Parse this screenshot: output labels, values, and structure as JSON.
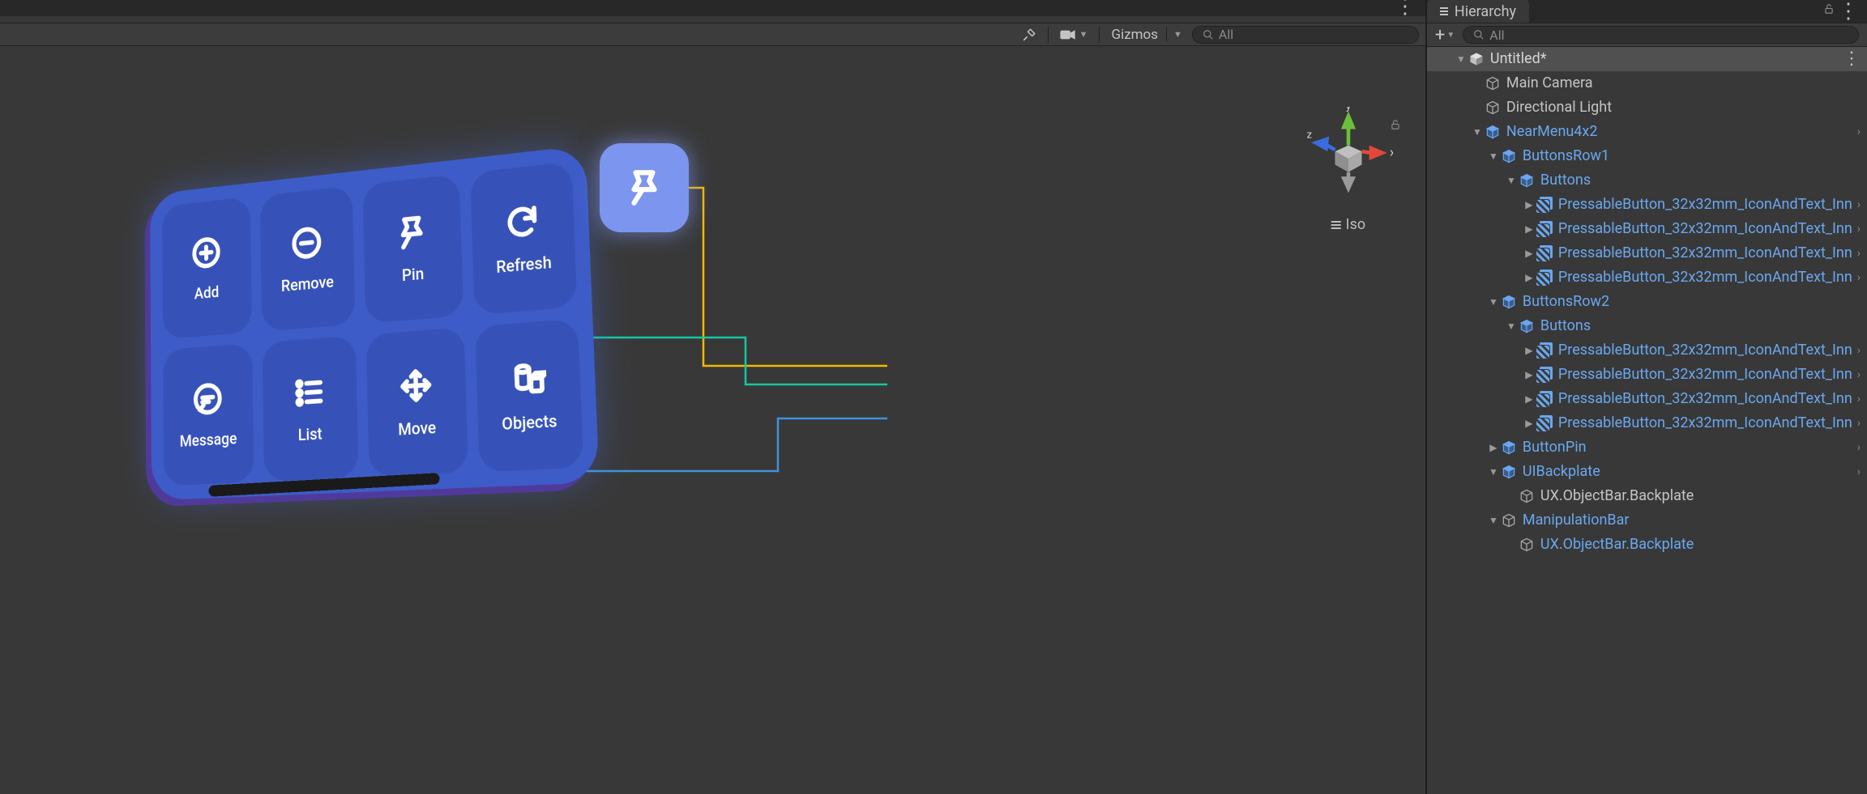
{
  "scene": {
    "toolbar": {
      "gizmos_label": "Gizmos",
      "search_placeholder": "All"
    },
    "view_mode_label": "Iso",
    "axes": {
      "x": "x",
      "y": "y",
      "z": "z"
    },
    "nearmenu_buttons": [
      {
        "label": "Add",
        "icon": "plus-circle-icon"
      },
      {
        "label": "Remove",
        "icon": "minus-circle-icon"
      },
      {
        "label": "Pin",
        "icon": "pin-icon"
      },
      {
        "label": "Refresh",
        "icon": "refresh-icon"
      },
      {
        "label": "Message",
        "icon": "message-icon"
      },
      {
        "label": "List",
        "icon": "list-icon"
      },
      {
        "label": "Move",
        "icon": "move-icon"
      },
      {
        "label": "Objects",
        "icon": "objects-icon"
      }
    ],
    "connectors": [
      {
        "color": "#f2b900",
        "from": "pin-button",
        "to": "ButtonPin"
      },
      {
        "color": "#14c8a0",
        "from": "ui-backplate",
        "to": "UIBackplate"
      },
      {
        "color": "#3f93d9",
        "from": "manipulation-bar",
        "to": "ManipulationBar"
      }
    ]
  },
  "hierarchy": {
    "panel_title": "Hierarchy",
    "add_label": "+",
    "search_placeholder": "All",
    "scene_name": "Untitled*",
    "items": [
      {
        "depth": 1,
        "label": "Main Camera",
        "icon": "cube-gray",
        "color": "gray",
        "arrow": ""
      },
      {
        "depth": 1,
        "label": "Directional Light",
        "icon": "cube-gray",
        "color": "gray",
        "arrow": ""
      },
      {
        "depth": 1,
        "label": "NearMenu4x2",
        "icon": "cube-blue",
        "color": "blue",
        "arrow": "down",
        "chev": true
      },
      {
        "depth": 2,
        "label": "ButtonsRow1",
        "icon": "cube-blue",
        "color": "blue",
        "arrow": "down"
      },
      {
        "depth": 3,
        "label": "Buttons",
        "icon": "cube-blue",
        "color": "blue",
        "arrow": "down"
      },
      {
        "depth": 4,
        "label": "PressableButton_32x32mm_IconAndText_Inn",
        "icon": "prefab-variant",
        "color": "blue",
        "arrow": "right",
        "chev": true
      },
      {
        "depth": 4,
        "label": "PressableButton_32x32mm_IconAndText_Inn",
        "icon": "prefab-variant",
        "color": "blue",
        "arrow": "right",
        "chev": true
      },
      {
        "depth": 4,
        "label": "PressableButton_32x32mm_IconAndText_Inn",
        "icon": "prefab-variant",
        "color": "blue",
        "arrow": "right",
        "chev": true
      },
      {
        "depth": 4,
        "label": "PressableButton_32x32mm_IconAndText_Inn",
        "icon": "prefab-variant",
        "color": "blue",
        "arrow": "right",
        "chev": true
      },
      {
        "depth": 2,
        "label": "ButtonsRow2",
        "icon": "cube-blue",
        "color": "blue",
        "arrow": "down"
      },
      {
        "depth": 3,
        "label": "Buttons",
        "icon": "cube-blue",
        "color": "blue",
        "arrow": "down"
      },
      {
        "depth": 4,
        "label": "PressableButton_32x32mm_IconAndText_Inn",
        "icon": "prefab-variant",
        "color": "blue",
        "arrow": "right",
        "chev": true
      },
      {
        "depth": 4,
        "label": "PressableButton_32x32mm_IconAndText_Inn",
        "icon": "prefab-variant",
        "color": "blue",
        "arrow": "right",
        "chev": true
      },
      {
        "depth": 4,
        "label": "PressableButton_32x32mm_IconAndText_Inn",
        "icon": "prefab-variant",
        "color": "blue",
        "arrow": "right",
        "chev": true
      },
      {
        "depth": 4,
        "label": "PressableButton_32x32mm_IconAndText_Inn",
        "icon": "prefab-variant",
        "color": "blue",
        "arrow": "right",
        "chev": true
      },
      {
        "depth": 2,
        "label": "ButtonPin",
        "icon": "cube-blue",
        "color": "blue",
        "arrow": "right",
        "chev": true
      },
      {
        "depth": 2,
        "label": "UIBackplate",
        "icon": "cube-blue",
        "color": "blue",
        "arrow": "down",
        "chev": true
      },
      {
        "depth": 3,
        "label": "UX.ObjectBar.Backplate",
        "icon": "cube-gray",
        "color": "gray",
        "arrow": ""
      },
      {
        "depth": 2,
        "label": "ManipulationBar",
        "icon": "cube-gray",
        "color": "blue",
        "arrow": "down"
      },
      {
        "depth": 3,
        "label": "UX.ObjectBar.Backplate",
        "icon": "cube-gray",
        "color": "blue",
        "arrow": ""
      }
    ]
  }
}
